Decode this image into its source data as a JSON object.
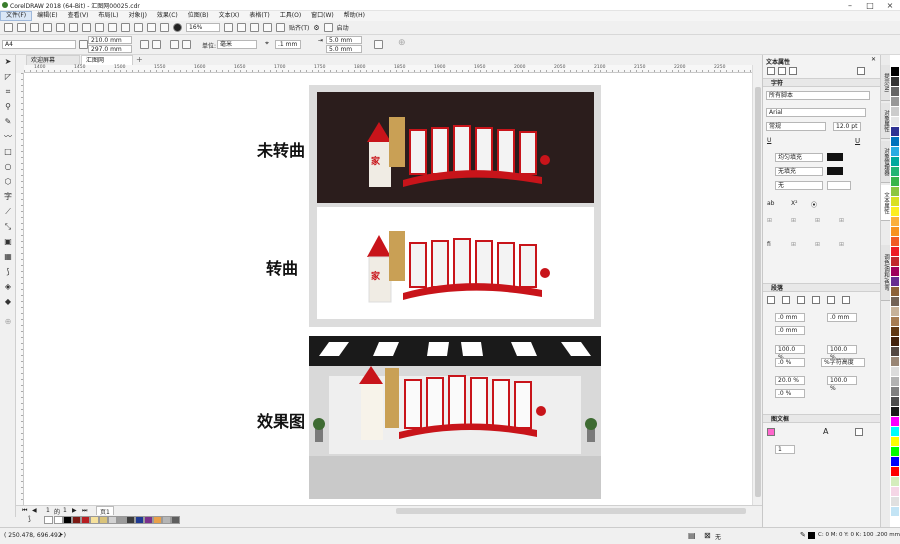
{
  "app": {
    "title": "CorelDRAW 2018 (64-Bit) - 汇图网00025.cdr"
  },
  "menu": [
    "文件(F)",
    "编辑(E)",
    "查看(V)",
    "布局(L)",
    "对象(J)",
    "效果(C)",
    "位图(B)",
    "文本(X)",
    "表格(T)",
    "工具(O)",
    "窗口(W)",
    "帮助(H)"
  ],
  "toolbar": {
    "zoom": "16%",
    "snap": "贴齐(T)",
    "launch": "启动"
  },
  "propbar": {
    "page_size": "A4",
    "width": "210.0 mm",
    "height": "297.0 mm",
    "unit_label": "单位:",
    "unit": "毫米",
    "nudge": ".1 mm",
    "dup_x": "5.0 mm",
    "dup_y": "5.0 mm"
  },
  "tabs": [
    {
      "label": "欢迎屏幕"
    },
    {
      "label": "汇图网00025.cdr"
    }
  ],
  "ruler_ticks": [
    "1400",
    "1450",
    "1500",
    "1550",
    "1600",
    "1650",
    "1700",
    "1750",
    "1800",
    "1850",
    "1900",
    "1950",
    "2000",
    "2050",
    "2100",
    "2150",
    "2200",
    "2250"
  ],
  "canvas": {
    "labels": [
      "未转曲",
      "转曲",
      "效果图"
    ],
    "artwork_colors": {
      "dark_bg": "#2b1d1c",
      "red": "#c8141a",
      "gold": "#c9a055",
      "gray": "#dcdcdc"
    }
  },
  "pagebar": {
    "current": "1",
    "of": "的",
    "total": "1",
    "page_tab": "页1"
  },
  "palette_colors": [
    "#ffffff",
    "#000000",
    "#7d1a14",
    "#b81e22",
    "#f6e19c",
    "#d9c37a",
    "#d2d2d2",
    "#9b9b9b",
    "#3c3c3c",
    "#1f3a93",
    "#7a2f8c",
    "#e9a04a",
    "#b5b5b5",
    "#5e5e5e"
  ],
  "status": {
    "coords": "( 250.478, 696.492 )",
    "fill": "无",
    "outline": "C: 0 M: 0 Y: 0 K: 100 .200 mm"
  },
  "panel": {
    "title": "文本属性",
    "char_section": "字符",
    "script": "所有脚本",
    "font": "Arial",
    "style": "常规",
    "size": "12.0 pt",
    "fill_type": "均匀填充",
    "bg_fill": "无填充",
    "outline": "无",
    "para_section": "段落",
    "para_values": [
      ".0 mm",
      ".0 mm",
      ".0 mm",
      "100.0 %",
      "100.0 %",
      ".0 %",
      "%字符高度",
      "20.0 %",
      "100.0 %",
      ".0 %"
    ],
    "frame_section": "图文框",
    "frame_cols": "1"
  },
  "dock_tabs": [
    "提示(N)",
    "对象属性",
    "对象管理器",
    "文本属性",
    "调色/调和/色弯"
  ],
  "color_strip": [
    "#ffffff",
    "#000000",
    "#333333",
    "#666666",
    "#999999",
    "#cccccc",
    "#e6e6e6",
    "#2e3192",
    "#0071bc",
    "#29abe2",
    "#00a99d",
    "#22b573",
    "#39b54a",
    "#8cc63f",
    "#d9e021",
    "#fcee21",
    "#fbb03b",
    "#f7931e",
    "#f15a24",
    "#ed1c24",
    "#c1272d",
    "#9e005d",
    "#662d91",
    "#8c6239",
    "#736357",
    "#c7b299",
    "#a67c52",
    "#603813",
    "#42210b",
    "#534741",
    "#998675",
    "#dcdcdc",
    "#b3b3b3",
    "#808080",
    "#4d4d4d",
    "#1a1a1a",
    "#ff00ff",
    "#00ffff",
    "#ffff00",
    "#00ff00",
    "#0000ff",
    "#ff0000",
    "#d4edbc",
    "#f5d6e6",
    "#e0e0e0",
    "#c3e4f5"
  ]
}
